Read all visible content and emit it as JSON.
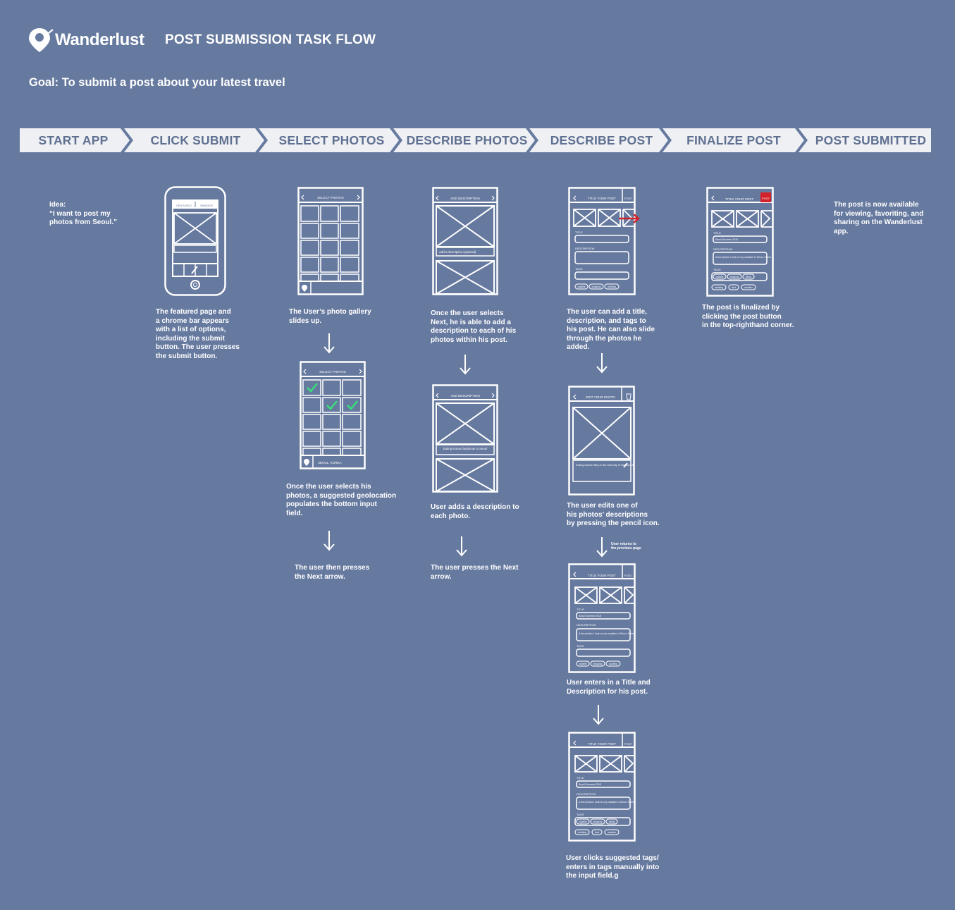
{
  "header": {
    "brand": "Wanderlust",
    "title": "POST SUBMISSION TASK FLOW",
    "goal": "Goal:  To submit a post about your latest travel"
  },
  "steps": [
    "START APP",
    "CLICK SUBMIT",
    "SELECT PHOTOS",
    "DESCRIBE PHOTOS",
    "DESCRIBE POST",
    "FINALIZE POST",
    "POST SUBMITTED"
  ],
  "notes": {
    "idea": "Idea:\n“I want to post my\nphotos from Seoul.”",
    "featured": "The featured page and\na chrome bar appears\nwith a list of options,\nincluding the submit\nbutton. The user presses\nthe submit button.",
    "gallery": "The User’s photo gallery\nslides up.",
    "geolocation": "Once the user selects his\nphotos, a suggested geolocation\npopulates the bottom input\nfield.",
    "next_arrow_1": "The user then presses\nthe Next arrow.",
    "describe_each": "Once the user selects\nNext, he is able to add a\ndescription to each of his\nphotos within his post.",
    "adds_description": "User adds a description to\neach photo.",
    "next_arrow_2": "The user presses the Next\narrow.",
    "title_desc_tags": "The user can add a title,\ndescription, and tags to\nhis post. He can also slide\nthrough the photos he\nadded.",
    "edits_photo": "The user edits one of\nhis photos’ descriptions\nby pressing the pencil icon.",
    "returns": "User returns to\nthe previous page",
    "enters_title": "User enters in a Title and\nDescription for his post.",
    "clicks_tags": "User clicks suggested tags/\nenters in tags manually into\nthe input field.g",
    "finalized": "The post is finalized by\nclicking the post button\nin the top-righthand corner.",
    "available": "The post is now available\nfor viewing, favoriting, and\nsharing on the Wanderlust\napp."
  },
  "wireframes": {
    "featured_tab": "FEATURED",
    "wander_tab": "WANDER",
    "select_photos": "SELECT PHOTOS",
    "location_value": "SEOUL, KOREA",
    "add_description": "ADD DESCRIPTION",
    "desc_placeholder": "Add a description (optional)",
    "desc_value": "Eating korean barbecue in Seoul",
    "title_your_post": "TITLE YOUR POST",
    "post_btn": "POST",
    "title_label": "TITLE",
    "description_label": "DESCRIPTION",
    "tags_label": "TAGS",
    "edit_your_photo": "EDIT YOUR PHOTO",
    "edit_desc_value": "Eating korean bbq in the best city in the world!",
    "title_value": "Seoul Summer 2015",
    "post_desc_value": "A few photos I took on my vacation in Seoul, Korea",
    "tag_nightlife": "nightlife",
    "tag_shopping": "shopping",
    "tag_clubbing": "clubbing",
    "tag_food": "food",
    "tag_vacation": "vacation",
    "tag_hiking": "hiking"
  },
  "colors": {
    "background": "#66799f",
    "banner": "#eef0f4",
    "banner_text": "#5f7091",
    "accent_red": "#d2232a",
    "check_green": "#39e079"
  }
}
